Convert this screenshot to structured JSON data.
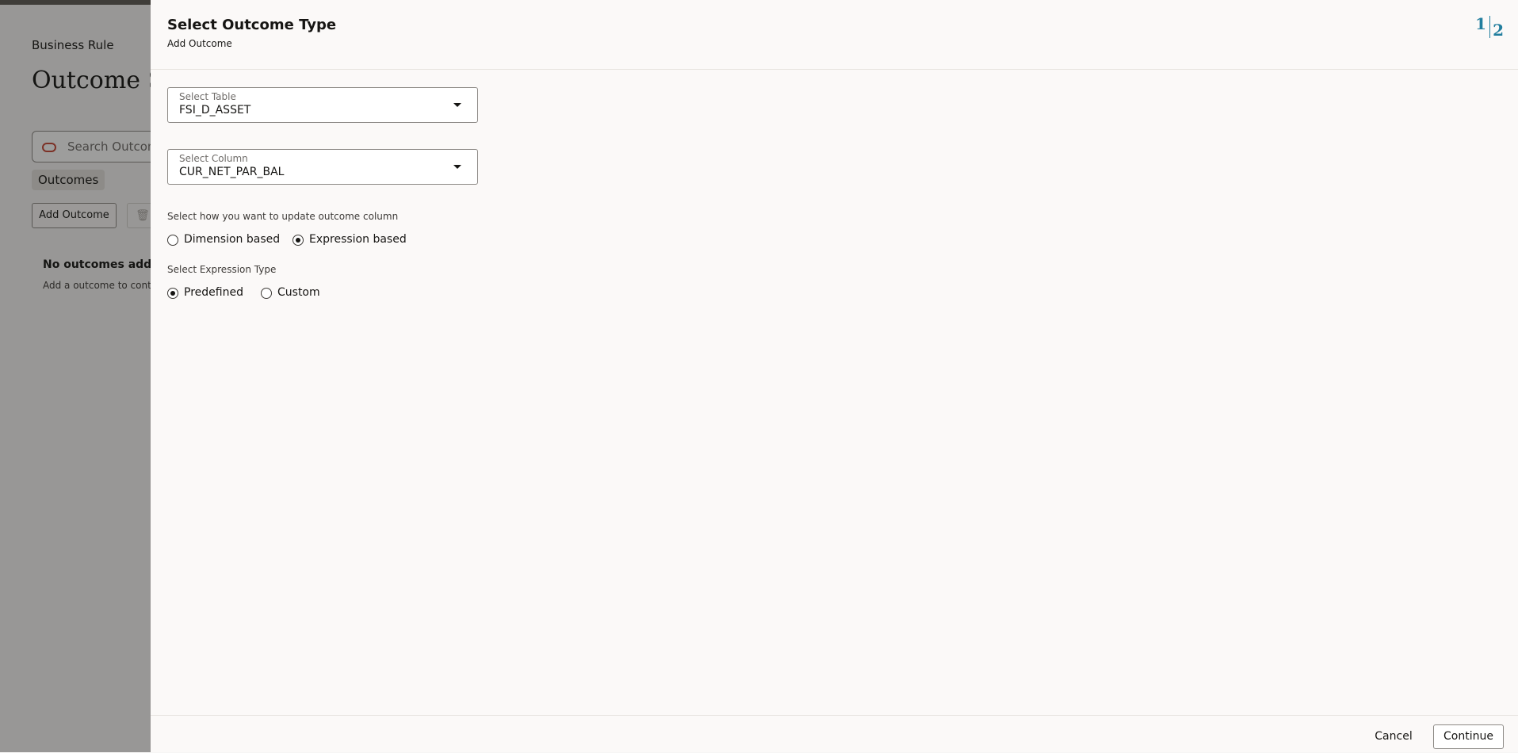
{
  "background": {
    "breadcrumb": "Business Rule",
    "page_title": "Outcome Se",
    "search_placeholder": "Search Outcome",
    "tab_chip": "Outcomes",
    "add_outcome_button": "Add Outcome",
    "empty_title": "No outcomes added.",
    "empty_text": "Add a outcome to continu"
  },
  "drawer": {
    "title": "Select Outcome Type",
    "subtitle": "Add Outcome",
    "train": {
      "step1": "1",
      "step2": "2"
    },
    "select_table": {
      "label": "Select Table",
      "value": "FSI_D_ASSET"
    },
    "select_column": {
      "label": "Select Column",
      "value": "CUR_NET_PAR_BAL"
    },
    "update_method": {
      "label": "Select how you want to update outcome column",
      "options": [
        "Dimension based",
        "Expression based"
      ],
      "selected": "Expression based"
    },
    "expression_type": {
      "label": "Select Expression Type",
      "options": [
        "Predefined",
        "Custom"
      ],
      "selected": "Predefined"
    },
    "footer": {
      "cancel": "Cancel",
      "continue": "Continue"
    }
  }
}
